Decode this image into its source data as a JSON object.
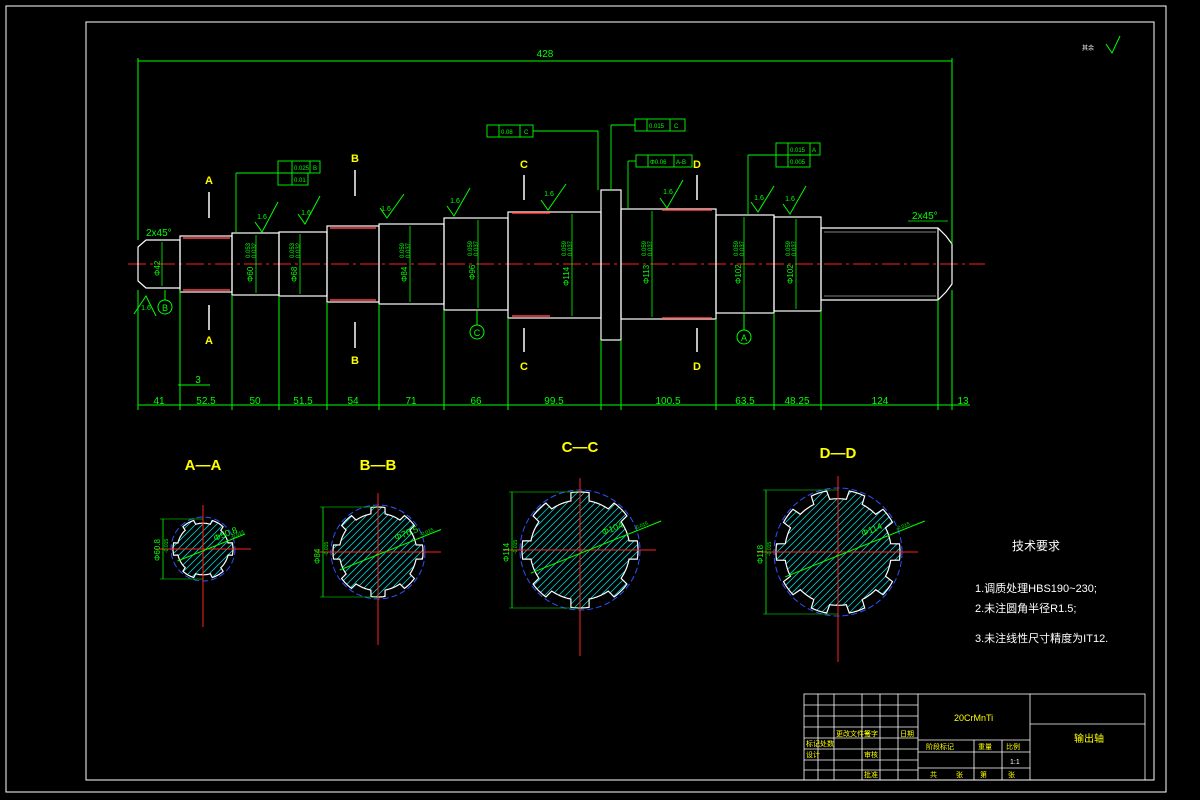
{
  "colors": {
    "background": "#000000",
    "outline": "#ffffff",
    "dimension": "#00ff00",
    "centerline": "#ff2020",
    "label": "#ffff00",
    "hatch": "#00cccc",
    "spline_circle": "#3050ff",
    "thread": "#ff4040"
  },
  "overall_length": "428",
  "chamfers": {
    "left": "2x45°",
    "right": "2x45°"
  },
  "segment_lengths": [
    "41",
    "52.5",
    "50",
    "51.5",
    "54",
    "71",
    "66",
    "99.5",
    "100.5",
    "63.5",
    "48.25",
    "124",
    "13"
  ],
  "small_dim": "3",
  "section_markers": {
    "a": "A",
    "b": "B",
    "c": "C",
    "d": "D"
  },
  "roughness": "1.6",
  "datums": {
    "b": "B",
    "c": "C",
    "a": "A"
  },
  "tolerance_frames": {
    "f1": {
      "tol": "0.025",
      "datum": "B"
    },
    "f2": {
      "tol": "0.01"
    },
    "f3": {
      "tol": "0.08",
      "datum": "C"
    },
    "f4": {
      "tol": "0.015",
      "datum": "C"
    },
    "f5": {
      "tol": "Φ0.06",
      "datum": "A-B"
    },
    "f6": {
      "tol": "0.015",
      "datum": "A"
    },
    "f7": {
      "tol": "0.005"
    }
  },
  "diameters": {
    "d1": "Φ42",
    "d2": "Φ60",
    "d3": "Φ68",
    "d4": "Φ84",
    "d5": "Φ96",
    "d6": "Φ114",
    "d7": "Φ113",
    "d8": "Φ102",
    "d9": "Φ102"
  },
  "fit_tolerance": {
    "upper1": "0.059",
    "lower1": "0.037",
    "upper2": "0.053",
    "lower2": "0.032"
  },
  "sections": [
    {
      "title": "A—A",
      "outer": "Φ50.8",
      "inner": "Φ60.8",
      "tol": "-0.015"
    },
    {
      "title": "B—B",
      "outer": "Φ76.5",
      "inner": "Φ84",
      "tol": "-0.015"
    },
    {
      "title": "C—C",
      "outer": "Φ104",
      "inner": "Φ114",
      "tol": "-0.015"
    },
    {
      "title": "D—D",
      "outer": "Φ114",
      "inner": "Φ118",
      "tol": "-0.015"
    }
  ],
  "tech_requirements": {
    "title": "技术要求",
    "items": [
      "1.调质处理HBS190~230;",
      "2.未注圆角半径R1.5;",
      "3.未注线性尺寸精度为IT12."
    ]
  },
  "roughness_corner": "其余",
  "title_block": {
    "material": "20CrMnTi",
    "part_name": "输出轴",
    "scale": "1:1",
    "cells_upper": [
      "标记",
      "处数",
      "更改文件号",
      "签字",
      "日期"
    ],
    "cells_lower": [
      "设计",
      "审核",
      "批准"
    ],
    "cells_right": [
      "阶段标记",
      "重量",
      "比例"
    ],
    "sheet": [
      "共",
      "张",
      "第",
      "张"
    ]
  }
}
